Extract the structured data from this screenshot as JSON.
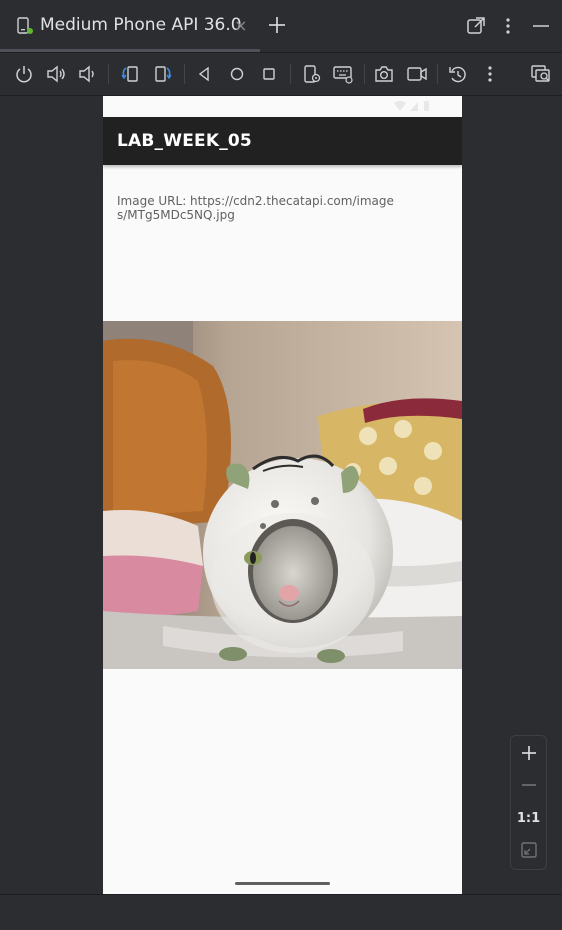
{
  "tab": {
    "title": "Medium Phone API 36.0",
    "close_glyph": "×",
    "icon": "device-phone-icon"
  },
  "toolbar": {
    "icons": [
      "power-icon",
      "volume-up-icon",
      "volume-down-icon",
      "rotate-left-icon",
      "rotate-right-icon",
      "back-icon",
      "home-icon",
      "overview-icon",
      "device-settings-icon",
      "keyboard-icon",
      "screenshot-icon",
      "screen-record-icon",
      "snapshot-icon",
      "more-icon",
      "device-mirror-icon"
    ]
  },
  "device": {
    "app_title": "LAB_WEEK_05",
    "image_url_text": "Image URL: https://cdn2.thecatapi.com/images/MTg5MDc5NQ.jpg",
    "image_subject": "cat-in-ceramic-pig-image"
  },
  "zoom": {
    "actual_size_label": "1:1"
  },
  "colors": {
    "ide_background": "#2b2d30",
    "app_bar": "#212121",
    "phone_background": "#fafafa"
  }
}
